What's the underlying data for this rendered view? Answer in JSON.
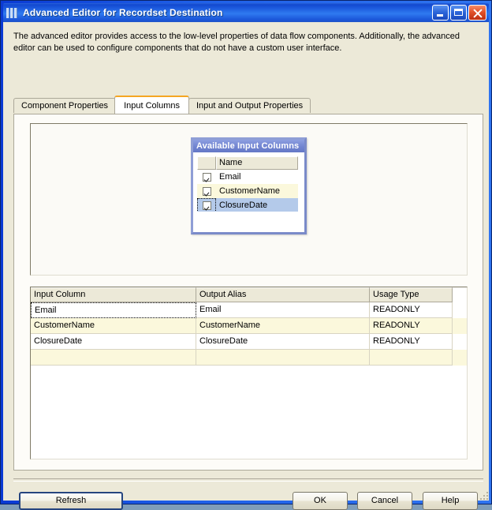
{
  "window": {
    "title": "Advanced Editor for Recordset Destination",
    "icon": "app-bars-icon",
    "controls": {
      "minimize": "Minimize",
      "maximize": "Maximize",
      "close": "Close"
    }
  },
  "description": "The advanced editor provides access to the low-level properties of data flow components. Additionally, the advanced editor can be used to configure components that do not have a custom user interface.",
  "tabs": [
    {
      "label": "Component Properties",
      "active": false
    },
    {
      "label": "Input Columns",
      "active": true
    },
    {
      "label": "Input and Output Properties",
      "active": false
    }
  ],
  "available_input_columns": {
    "title": "Available Input Columns",
    "columns": [
      "",
      "Name"
    ],
    "rows": [
      {
        "checked": true,
        "name": "Email",
        "state": "normal"
      },
      {
        "checked": true,
        "name": "CustomerName",
        "state": "alt"
      },
      {
        "checked": true,
        "name": "ClosureDate",
        "state": "selected"
      }
    ]
  },
  "mapping_grid": {
    "headers": [
      "Input Column",
      "Output Alias",
      "Usage Type"
    ],
    "rows": [
      {
        "input_column": "Email",
        "output_alias": "Email",
        "usage_type": "READONLY",
        "state": "focused"
      },
      {
        "input_column": "CustomerName",
        "output_alias": "CustomerName",
        "usage_type": "READONLY",
        "state": "alt"
      },
      {
        "input_column": "ClosureDate",
        "output_alias": "ClosureDate",
        "usage_type": "READONLY",
        "state": "normal"
      },
      {
        "input_column": "",
        "output_alias": "",
        "usage_type": "",
        "state": "alt"
      }
    ]
  },
  "buttons": {
    "refresh": "Refresh",
    "ok": "OK",
    "cancel": "Cancel",
    "help": "Help"
  },
  "colors": {
    "accent_tab": "#f5a623",
    "panel_header": "#7386d2",
    "selection": "#b4caea",
    "alt_row": "#fbf8dc",
    "face": "#ece9d8"
  }
}
